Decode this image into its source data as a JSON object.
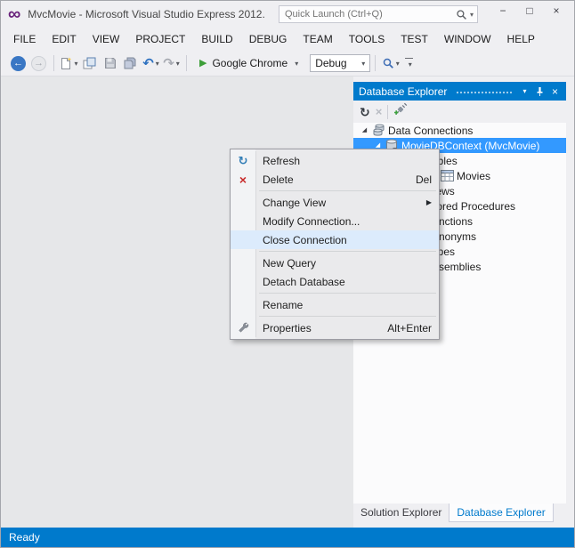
{
  "window": {
    "title": "MvcMovie - Microsoft Visual Studio Express 2012...",
    "quick_launch_placeholder": "Quick Launch (Ctrl+Q)"
  },
  "menu_bar": [
    "FILE",
    "EDIT",
    "VIEW",
    "PROJECT",
    "BUILD",
    "DEBUG",
    "TEAM",
    "TOOLS",
    "TEST",
    "WINDOW",
    "HELP"
  ],
  "toolbar": {
    "run_target_label": "Google Chrome",
    "config_value": "Debug"
  },
  "database_explorer": {
    "title": "Database Explorer",
    "tree": {
      "items": [
        {
          "label": "Data Connections"
        },
        {
          "label": "MovieDBContext (MvcMovie)",
          "selected": true
        },
        {
          "label": "Tables"
        },
        {
          "label": "Movies"
        },
        {
          "label": "Views"
        },
        {
          "label": "Stored Procedures"
        },
        {
          "label": "Functions"
        },
        {
          "label": "Synonyms"
        },
        {
          "label": "Types"
        },
        {
          "label": "Assemblies"
        }
      ]
    }
  },
  "context_menu": {
    "items": [
      {
        "label": "Refresh"
      },
      {
        "label": "Delete",
        "shortcut": "Del"
      },
      {
        "label": "Change View",
        "has_submenu": true
      },
      {
        "label": "Modify Connection..."
      },
      {
        "label": "Close Connection",
        "highlighted": true
      },
      {
        "label": "New Query"
      },
      {
        "label": "Detach Database"
      },
      {
        "label": "Rename"
      },
      {
        "label": "Properties",
        "shortcut": "Alt+Enter"
      }
    ]
  },
  "panel_tabs": [
    "Solution Explorer",
    "Database Explorer"
  ],
  "status_bar": {
    "text": "Ready"
  },
  "icons": {
    "logo_infinity": "∞",
    "minimize": "−",
    "maximize": "□",
    "close": "×",
    "dropdown_caret": "▾",
    "back_arrow": "←",
    "forward_arrow": "→",
    "undo": "↶",
    "redo": "↷",
    "run_play": "▶",
    "refresh": "↻",
    "delete_x": "×",
    "submenu_arrow": "▶",
    "expander_expanded": "◢",
    "expander_collapsed": "▷"
  },
  "colors": {
    "accent_blue": "#007ACC",
    "tree_selection": "#3399FF",
    "menu_highlight": "#DCEBFC",
    "delete_red": "#C82A2A",
    "run_green": "#3D9E39",
    "logo_purple": "#68217A"
  }
}
